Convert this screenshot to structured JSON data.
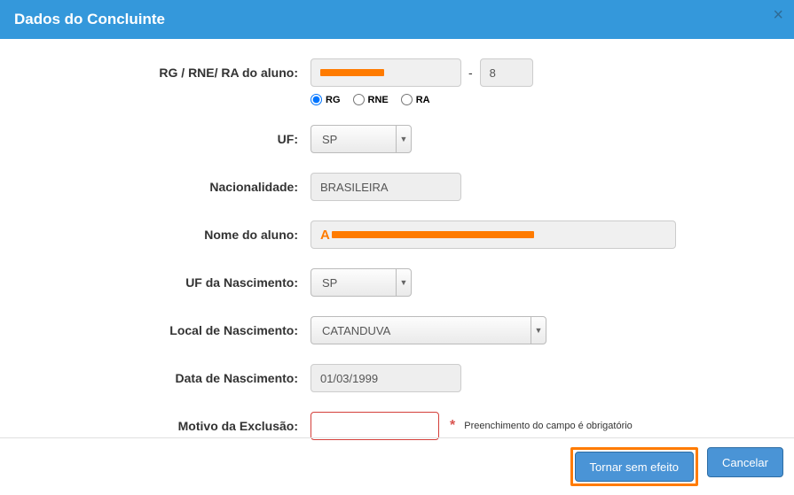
{
  "header": {
    "title": "Dados do Concluinte",
    "close_glyph": "×"
  },
  "labels": {
    "rg": "RG / RNE/ RA do aluno:",
    "uf": "UF:",
    "nacionalidade": "Nacionalidade:",
    "nome": "Nome do aluno:",
    "uf_nasc": "UF da Nascimento:",
    "local_nasc": "Local de Nascimento:",
    "data_nasc": "Data de Nascimento:",
    "motivo": "Motivo da Exclusão:"
  },
  "values": {
    "rg_digit": "8",
    "uf": "SP",
    "nacionalidade": "BRASILEIRA",
    "uf_nasc": "SP",
    "local_nasc": "CATANDUVA",
    "data_nasc": "01/03/1999",
    "motivo": ""
  },
  "radios": {
    "rg": "RG",
    "rne": "RNE",
    "ra": "RA",
    "selected": "rg"
  },
  "messages": {
    "required": "Preenchimento do campo é obrigatório"
  },
  "buttons": {
    "primary": "Tornar sem efeito",
    "cancel": "Cancelar"
  }
}
